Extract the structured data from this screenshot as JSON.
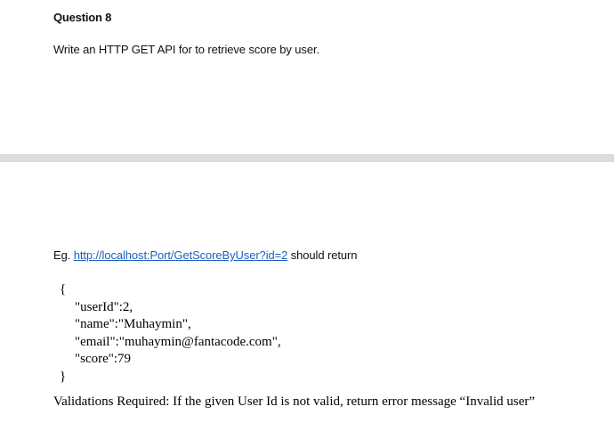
{
  "question": {
    "heading": "Question 8",
    "text": "Write an HTTP GET API for to retrieve score by user."
  },
  "example": {
    "prefix": "Eg. ",
    "link_text": "http://localhost:Port/GetScoreByUser?id=2",
    "suffix": " should return"
  },
  "response_json": {
    "open_brace": "{",
    "lines": [
      "\"userId\":2,",
      "\"name\":\"Muhaymin\",",
      "\"email\":\"muhaymin@fantacode.com\",",
      "\"score\":79"
    ],
    "close_brace": "}"
  },
  "validation": {
    "text": "Validations Required: If the given User Id is not valid, return error message “Invalid user”"
  }
}
